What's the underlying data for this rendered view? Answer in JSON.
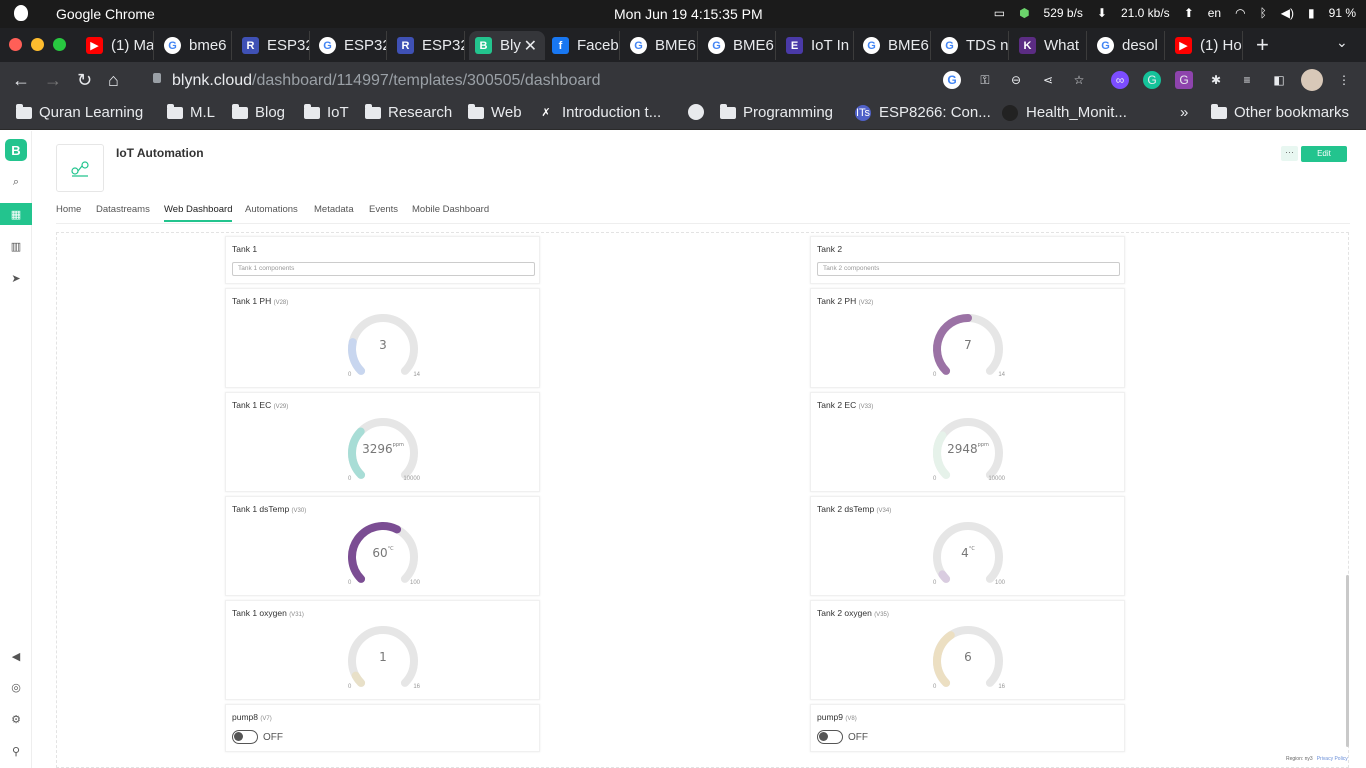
{
  "os": {
    "app_name": "Google Chrome",
    "datetime": "Mon Jun 19   4:15:35 PM",
    "net_up": "529 b/s",
    "net_down": "21.0 kb/s",
    "lang": "en",
    "battery": "91 %"
  },
  "tabs": [
    {
      "label": "(1) Ma",
      "icon": "youtube-icon",
      "color": "#ff0000"
    },
    {
      "label": "bme6",
      "icon": "google-icon",
      "color": "#ffffff"
    },
    {
      "label": "ESP32",
      "icon": "r-icon",
      "color": "#3f51b5"
    },
    {
      "label": "ESP32",
      "icon": "google-icon",
      "color": "#ffffff"
    },
    {
      "label": "ESP32",
      "icon": "r-icon",
      "color": "#3f51b5"
    },
    {
      "label": "Bly",
      "icon": "blynk-icon",
      "color": "#23c48e"
    },
    {
      "label": "Faceb",
      "icon": "facebook-icon",
      "color": "#1877f2"
    },
    {
      "label": "BME6",
      "icon": "google-icon",
      "color": "#ffffff"
    },
    {
      "label": "BME6",
      "icon": "google-icon",
      "color": "#ffffff"
    },
    {
      "label": "IoT In",
      "icon": "iot-icon",
      "color": "#4a3aa8"
    },
    {
      "label": "BME6",
      "icon": "google-icon",
      "color": "#ffffff"
    },
    {
      "label": "TDS n",
      "icon": "google-icon",
      "color": "#ffffff"
    },
    {
      "label": "What",
      "icon": "k-icon",
      "color": "#5b2c83"
    },
    {
      "label": "desol",
      "icon": "google-icon",
      "color": "#ffffff"
    },
    {
      "label": "(1) Ho",
      "icon": "youtube-icon",
      "color": "#ff0000"
    }
  ],
  "address": {
    "host": "blynk.cloud",
    "path": "/dashboard/114997/templates/300505/dashboard"
  },
  "bookmarks": [
    {
      "label": "Quran Learning",
      "type": "folder"
    },
    {
      "label": "M.L",
      "type": "folder"
    },
    {
      "label": "Blog",
      "type": "folder"
    },
    {
      "label": "IoT",
      "type": "folder"
    },
    {
      "label": "Research",
      "type": "folder"
    },
    {
      "label": "Web",
      "type": "folder"
    },
    {
      "label": "Introduction t...",
      "type": "x"
    },
    {
      "label": "",
      "type": "globe"
    },
    {
      "label": "Programming",
      "type": "folder"
    },
    {
      "label": "ESP8266: Con...",
      "type": "site"
    },
    {
      "label": "Health_Monit...",
      "type": "github"
    }
  ],
  "bookmarks_overflow": "»",
  "other_bookmarks": "Other bookmarks",
  "blynk": {
    "logo": "B",
    "template_title": "IoT Automation",
    "more_label": "···",
    "edit_label": "Edit",
    "tabs": [
      "Home",
      "Datastreams",
      "Web Dashboard",
      "Automations",
      "Metadata",
      "Events",
      "Mobile Dashboard"
    ],
    "active_tab": "Web Dashboard"
  },
  "tanks": [
    {
      "title": "Tank 1",
      "placeholder": "Tank 1 components",
      "gauges": [
        {
          "label": "Tank 1 PH",
          "pin": "(V28)",
          "value": 3,
          "unit": "",
          "min": 0,
          "max": 14,
          "color": "#c8d6ef"
        },
        {
          "label": "Tank 1 EC",
          "pin": "(V29)",
          "value": 3296,
          "unit": "ppm",
          "min": 0,
          "max": 10000,
          "color": "#a8ddd6"
        },
        {
          "label": "Tank 1 dsTemp",
          "pin": "(V30)",
          "value": 60,
          "unit": "°C",
          "min": 0,
          "max": 100,
          "color": "#7b4d93"
        },
        {
          "label": "Tank 1 oxygen",
          "pin": "(V31)",
          "value": 1,
          "unit": "",
          "min": 0,
          "max": 16,
          "color": "#e8e0c8"
        }
      ],
      "switch": {
        "label": "pump8",
        "pin": "(V7)",
        "state": "OFF"
      }
    },
    {
      "title": "Tank 2",
      "placeholder": "Tank 2 components",
      "gauges": [
        {
          "label": "Tank 2 PH",
          "pin": "(V32)",
          "value": 7,
          "unit": "",
          "min": 0,
          "max": 14,
          "color": "#9b72a5"
        },
        {
          "label": "Tank 2 EC",
          "pin": "(V33)",
          "value": 2948,
          "unit": "ppm",
          "min": 0,
          "max": 10000,
          "color": "#e6f2ea"
        },
        {
          "label": "Tank 2 dsTemp",
          "pin": "(V34)",
          "value": 4,
          "unit": "°C",
          "min": 0,
          "max": 100,
          "color": "#d9cce0"
        },
        {
          "label": "Tank 2 oxygen",
          "pin": "(V35)",
          "value": 6,
          "unit": "",
          "min": 0,
          "max": 16,
          "color": "#ecdfc2"
        }
      ],
      "switch": {
        "label": "pump9",
        "pin": "(V8)",
        "state": "OFF"
      }
    }
  ],
  "footer": {
    "region": "Region: ny3",
    "privacy": "Privacy Policy"
  }
}
